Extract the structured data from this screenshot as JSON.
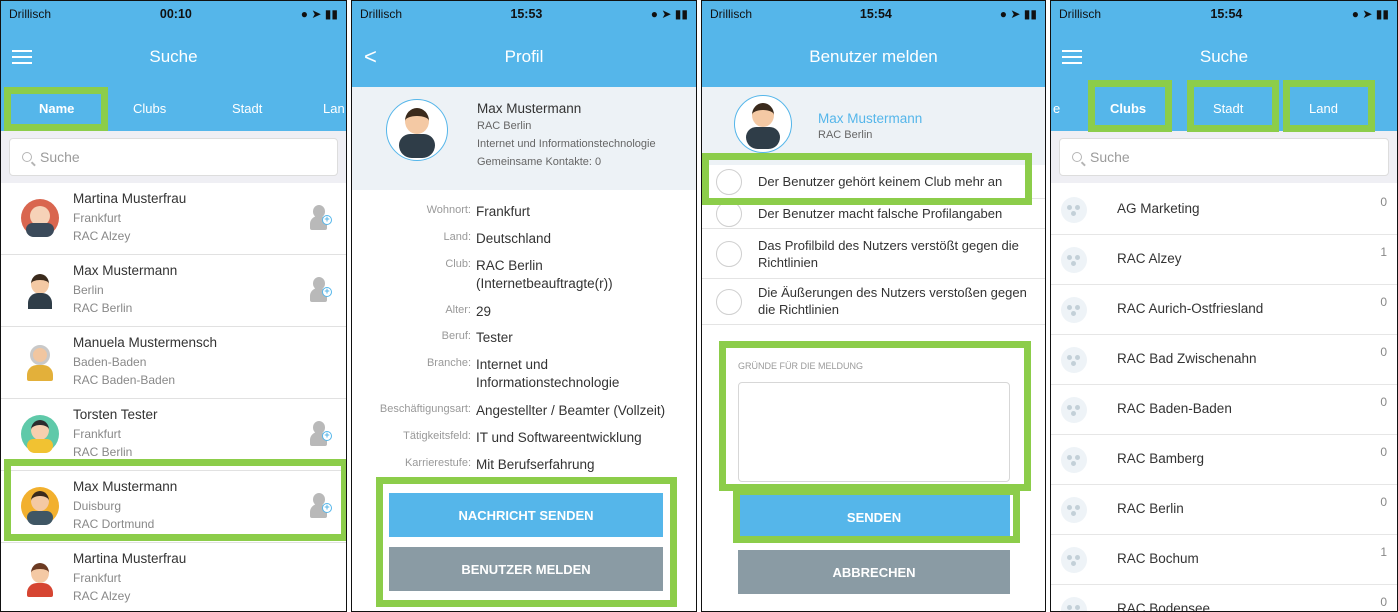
{
  "screen1": {
    "status": {
      "carrier": "Drillisch",
      "time": "00:10"
    },
    "title": "Suche",
    "tabs": [
      "Name",
      "Clubs",
      "Stadt",
      "Lan"
    ],
    "search_placeholder": "Suche",
    "people": [
      {
        "name": "Martina Musterfrau",
        "city": "Frankfurt",
        "club": "RAC Alzey"
      },
      {
        "name": "Max Mustermann",
        "city": "Berlin",
        "club": "RAC Berlin"
      },
      {
        "name": "Manuela Mustermensch",
        "city": "Baden-Baden",
        "club": "RAC Baden-Baden"
      },
      {
        "name": "Torsten Tester",
        "city": "Frankfurt",
        "club": "RAC Berlin"
      },
      {
        "name": "Max Mustermann",
        "city": "Duisburg",
        "club": "RAC Dortmund"
      },
      {
        "name": "Martina Musterfrau",
        "city": "Frankfurt",
        "club": "RAC Alzey"
      }
    ]
  },
  "screen2": {
    "status": {
      "carrier": "Drillisch",
      "time": "15:53"
    },
    "title": "Profil",
    "back": "<",
    "profile": {
      "name": "Max Mustermann",
      "club": "RAC Berlin",
      "industry": "Internet und Informationstechnologie",
      "contacts": "Gemeinsame Kontakte: 0"
    },
    "fields": [
      {
        "k": "Wohnort:",
        "v": "Frankfurt"
      },
      {
        "k": "Land:",
        "v": "Deutschland"
      },
      {
        "k": "Club:",
        "v": "RAC Berlin",
        "v2": "(Internetbeauftragte(r))"
      },
      {
        "k": "Alter:",
        "v": "29"
      },
      {
        "k": "Beruf:",
        "v": "Tester"
      },
      {
        "k": "Branche:",
        "v": "Internet und",
        "v2": "Informationstechnologie"
      },
      {
        "k": "Beschäftigungsart:",
        "v": "Angestellter / Beamter (Vollzeit)"
      },
      {
        "k": "Tätigkeitsfeld:",
        "v": "IT und Softwareentwicklung"
      },
      {
        "k": "Karrierestufe:",
        "v": "Mit Berufserfahrung"
      }
    ],
    "btn_message": "NACHRICHT SENDEN",
    "btn_report": "BENUTZER MELDEN"
  },
  "screen3": {
    "status": {
      "carrier": "Drillisch",
      "time": "15:54"
    },
    "title": "Benutzer melden",
    "user": {
      "name": "Max Mustermann",
      "club": "RAC Berlin"
    },
    "options": [
      {
        "line1": "Der Benutzer gehört keinem Club mehr an"
      },
      {
        "line1": "Der Benutzer macht falsche Profilangaben"
      },
      {
        "line1": "Das Profilbild des Nutzers verstößt gegen die",
        "line2": "Richtlinien"
      },
      {
        "line1": "Die Äußerungen des Nutzers verstoßen gegen",
        "line2": "die Richtlinien"
      }
    ],
    "reason_label": "GRÜNDE FÜR DIE MELDUNG",
    "btn_send": "SENDEN",
    "btn_cancel": "ABBRECHEN"
  },
  "screen4": {
    "status": {
      "carrier": "Drillisch",
      "time": "15:54"
    },
    "title": "Suche",
    "tab_partial": "e",
    "tabs": [
      "Clubs",
      "Stadt",
      "Land"
    ],
    "search_placeholder": "Suche",
    "clubs": [
      {
        "name": "AG Marketing",
        "count": "0"
      },
      {
        "name": "RAC Alzey",
        "count": "1"
      },
      {
        "name": "RAC Aurich-Ostfriesland",
        "count": "0"
      },
      {
        "name": "RAC Bad Zwischenahn",
        "count": "0"
      },
      {
        "name": "RAC Baden-Baden",
        "count": "0"
      },
      {
        "name": "RAC Bamberg",
        "count": "0"
      },
      {
        "name": "RAC Berlin",
        "count": "0"
      },
      {
        "name": "RAC Bochum",
        "count": "1"
      },
      {
        "name": "RAC Bodensee",
        "count": "0"
      }
    ]
  },
  "colors": {
    "accent": "#55b6ea",
    "highlight": "#8ccd4a",
    "secondary_button": "#8a9ba4"
  }
}
